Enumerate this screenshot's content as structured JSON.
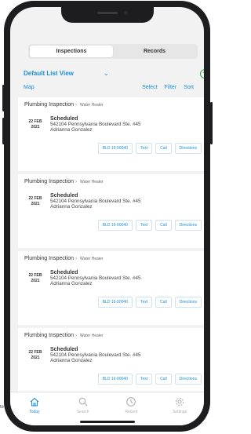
{
  "segment": {
    "tabs": [
      {
        "label": "Inspections"
      },
      {
        "label": "Records"
      }
    ]
  },
  "list": {
    "title": "Default List View",
    "chevron": "⌄",
    "add_icon": "+"
  },
  "actions": {
    "map": "Map",
    "select": "Select",
    "filter": "Filter",
    "sort": "Sort"
  },
  "cards": [
    {
      "title": "Plumbing Inspection",
      "subtitle": "Water Heater",
      "day": "22 FEB",
      "year": "2021",
      "status": "Scheduled",
      "address": "542104 Pennsylvania Boulevard Ste. #45",
      "person": "Adrianna Gonzalez",
      "record": "BLD 16-00040",
      "text": "Text",
      "call": "Call",
      "directions": "Directions"
    },
    {
      "title": "Plumbing Inspection",
      "subtitle": "Water Heater",
      "day": "22 FEB",
      "year": "2021",
      "status": "Scheduled",
      "address": "542104 Pennsylvania Boulevard Ste. #45",
      "person": "Adrianna Gonzalez",
      "record": "BLD 16-00040",
      "text": "Text",
      "call": "Call",
      "directions": "Directions"
    },
    {
      "title": "Plumbing Inspection",
      "subtitle": "Water Heater",
      "day": "22 FEB",
      "year": "2021",
      "status": "Scheduled",
      "address": "542104 Pennsylvania Boulevard Ste. #45",
      "person": "Adrianna Gonzalez",
      "record": "BLD 16-00040",
      "text": "Text",
      "call": "Call",
      "directions": "Directions"
    },
    {
      "title": "Plumbing Inspection",
      "subtitle": "Water Heater",
      "day": "22 FEB",
      "year": "2021",
      "status": "Scheduled",
      "address": "542104 Pennsylvania Boulevard Ste. #45",
      "person": "Adrianna Gonzalez",
      "record": "BLD 16-00040",
      "text": "Text",
      "call": "Call",
      "directions": "Directions"
    }
  ],
  "tabbar": {
    "items": [
      {
        "label": "Today",
        "icon": "home-icon"
      },
      {
        "label": "Search",
        "icon": "search-icon"
      },
      {
        "label": "Recent",
        "icon": "clock-icon"
      },
      {
        "label": "Settings",
        "icon": "gear-icon"
      }
    ]
  },
  "edge_text": "te",
  "colors": {
    "accent": "#1a8fd6",
    "add": "#36a852",
    "background": "#f2f2f2"
  }
}
